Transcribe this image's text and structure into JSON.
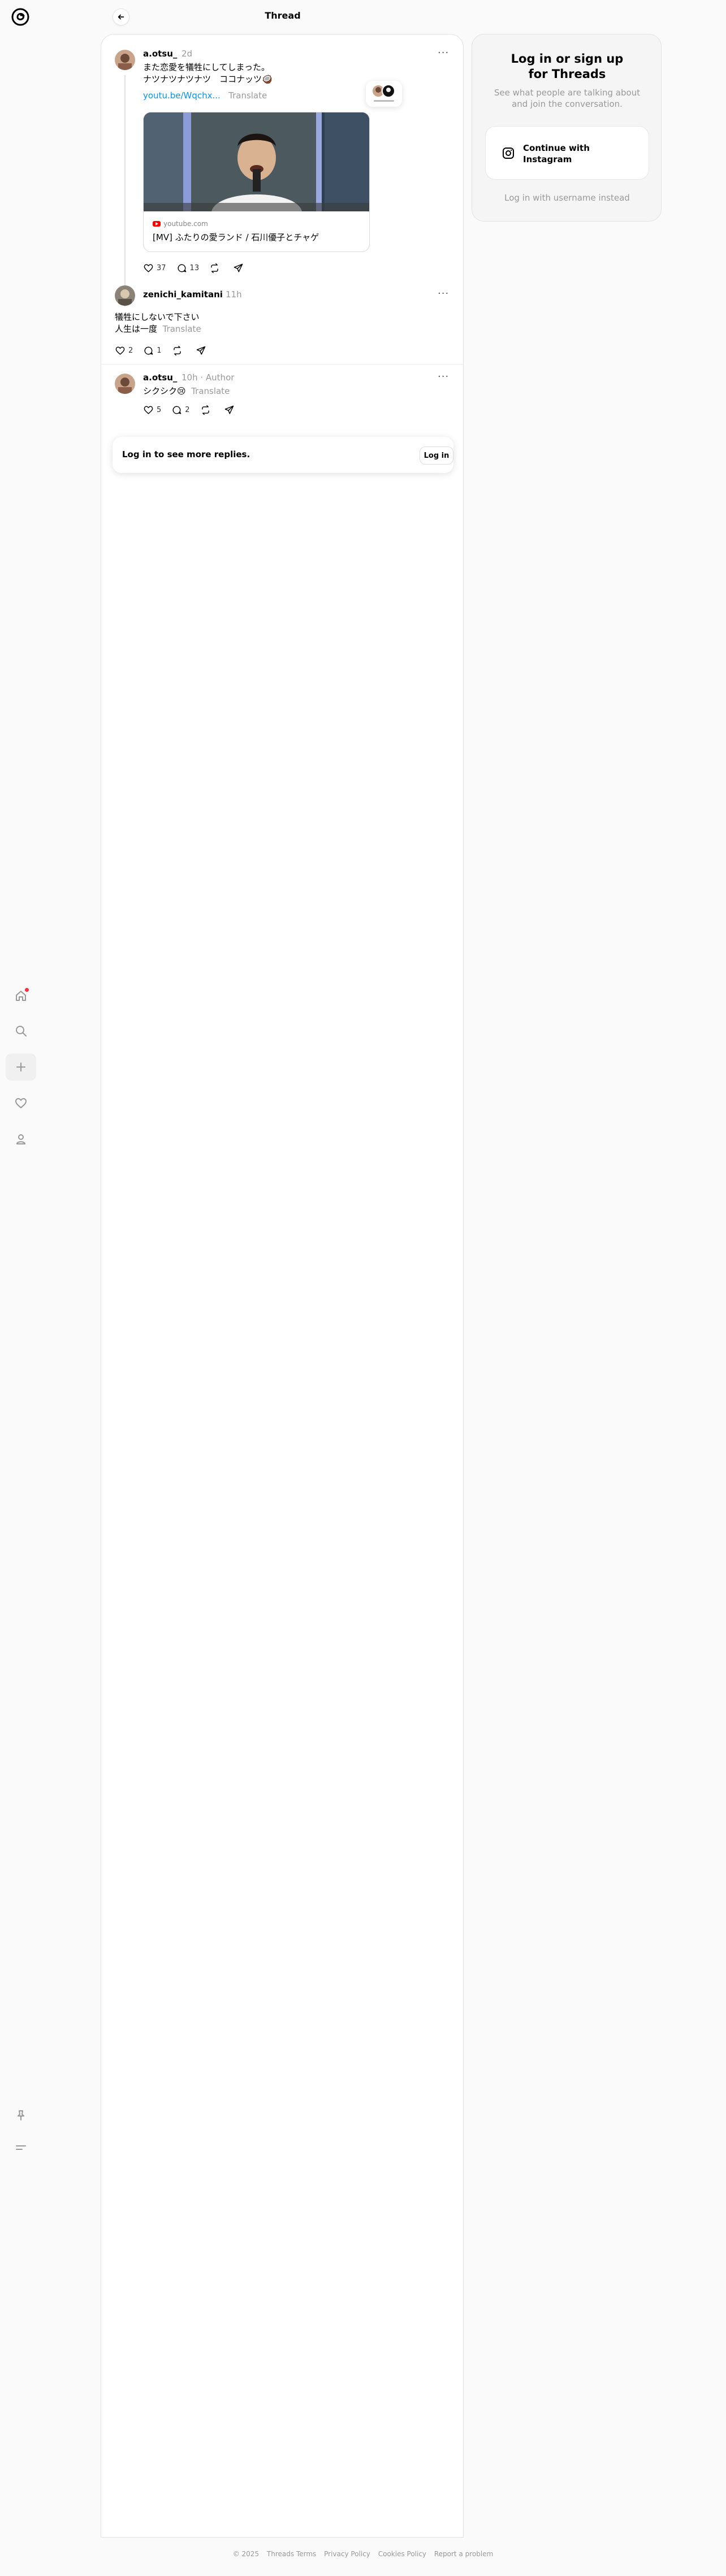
{
  "header": {
    "title": "Thread"
  },
  "posts": [
    {
      "username": "a.otsu_",
      "time": "2d",
      "text_line1": "また恋愛を犠牲にしてしまった。",
      "text_line2": "ナツナツナツナツ　ココナッツ🥥",
      "link": "youtu.be/Wqchx...",
      "translate": "Translate",
      "card": {
        "domain": "youtube.com",
        "title": "[MV] ふたりの愛ランド / 石川優子とチャゲ"
      },
      "likes": "37",
      "replies": "13"
    },
    {
      "username": "zenichi_kamitani",
      "time": "11h",
      "text_line1": "犠牲にしないで下さい",
      "text_line2": "人生は一度",
      "translate": "Translate",
      "likes": "2",
      "replies": "1"
    },
    {
      "username": "a.otsu_",
      "time": "10h",
      "author": "· Author",
      "text_line1": "シクシク😢",
      "translate": "Translate",
      "likes": "5",
      "replies": "2"
    }
  ],
  "login_bar": {
    "text": "Log in to see more replies.",
    "button": "Log in"
  },
  "sidebar_card": {
    "title_line1": "Log in or sign up",
    "title_line2": "for Threads",
    "subtitle": "See what people are talking about and join the conversation.",
    "instagram_line1": "Continue with",
    "instagram_line2": "Instagram",
    "alt_login": "Log in with username instead"
  },
  "footer": {
    "copyright": "© 2025",
    "terms": "Threads Terms",
    "privacy": "Privacy Policy",
    "cookies": "Cookies Policy",
    "report": "Report a problem"
  },
  "colors": {
    "accent": "#0095f6",
    "notification_dot": "#ff3040"
  }
}
